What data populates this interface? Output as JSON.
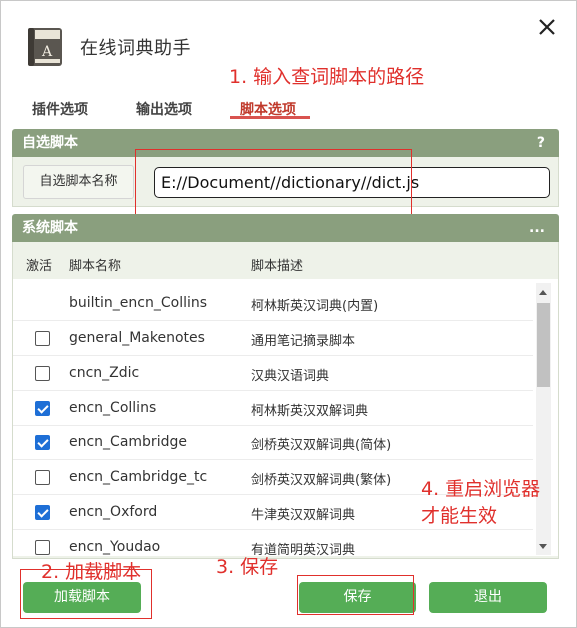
{
  "window": {
    "title": "在线词典助手"
  },
  "annotations": {
    "step1": "1. 输入查词脚本的路径",
    "step2": "2. 加载脚本",
    "step3": "3. 保存",
    "step4_line1": "4. 重启浏览器",
    "step4_line2": "才能生效"
  },
  "tabs": [
    {
      "label": "插件选项",
      "active": false
    },
    {
      "label": "输出选项",
      "active": false
    },
    {
      "label": "脚本选项",
      "active": true
    }
  ],
  "custom_script": {
    "header": "自选脚本",
    "help": "?",
    "name_label": "自选脚本名称",
    "path_value": "E://Document//dictionary//dict.js"
  },
  "system_scripts": {
    "header": "系统脚本",
    "more": "...",
    "columns": {
      "active": "激活",
      "name": "脚本名称",
      "desc": "脚本描述"
    },
    "rows": [
      {
        "name": "builtin_encn_Collins",
        "desc": "柯林斯英汉词典(内置)",
        "checkbox": false,
        "checked": false
      },
      {
        "name": "general_Makenotes",
        "desc": "通用笔记摘录脚本",
        "checkbox": true,
        "checked": false
      },
      {
        "name": "cncn_Zdic",
        "desc": "汉典汉语词典",
        "checkbox": true,
        "checked": false
      },
      {
        "name": "encn_Collins",
        "desc": "柯林斯英汉双解词典",
        "checkbox": true,
        "checked": true
      },
      {
        "name": "encn_Cambridge",
        "desc": "剑桥英汉双解词典(简体)",
        "checkbox": true,
        "checked": true
      },
      {
        "name": "encn_Cambridge_tc",
        "desc": "剑桥英汉双解词典(繁体)",
        "checkbox": true,
        "checked": false
      },
      {
        "name": "encn_Oxford",
        "desc": "牛津英汉双解词典",
        "checkbox": true,
        "checked": true
      },
      {
        "name": "encn_Youdao",
        "desc": "有道简明英汉词典",
        "checkbox": true,
        "checked": false
      }
    ]
  },
  "buttons": {
    "load": "加载脚本",
    "save": "保存",
    "exit": "退出"
  },
  "colors": {
    "accent": "#55ad56",
    "header_bg": "#8a9f7e",
    "annotation": "#e0302c",
    "checkbox": "#1e6fd6"
  }
}
